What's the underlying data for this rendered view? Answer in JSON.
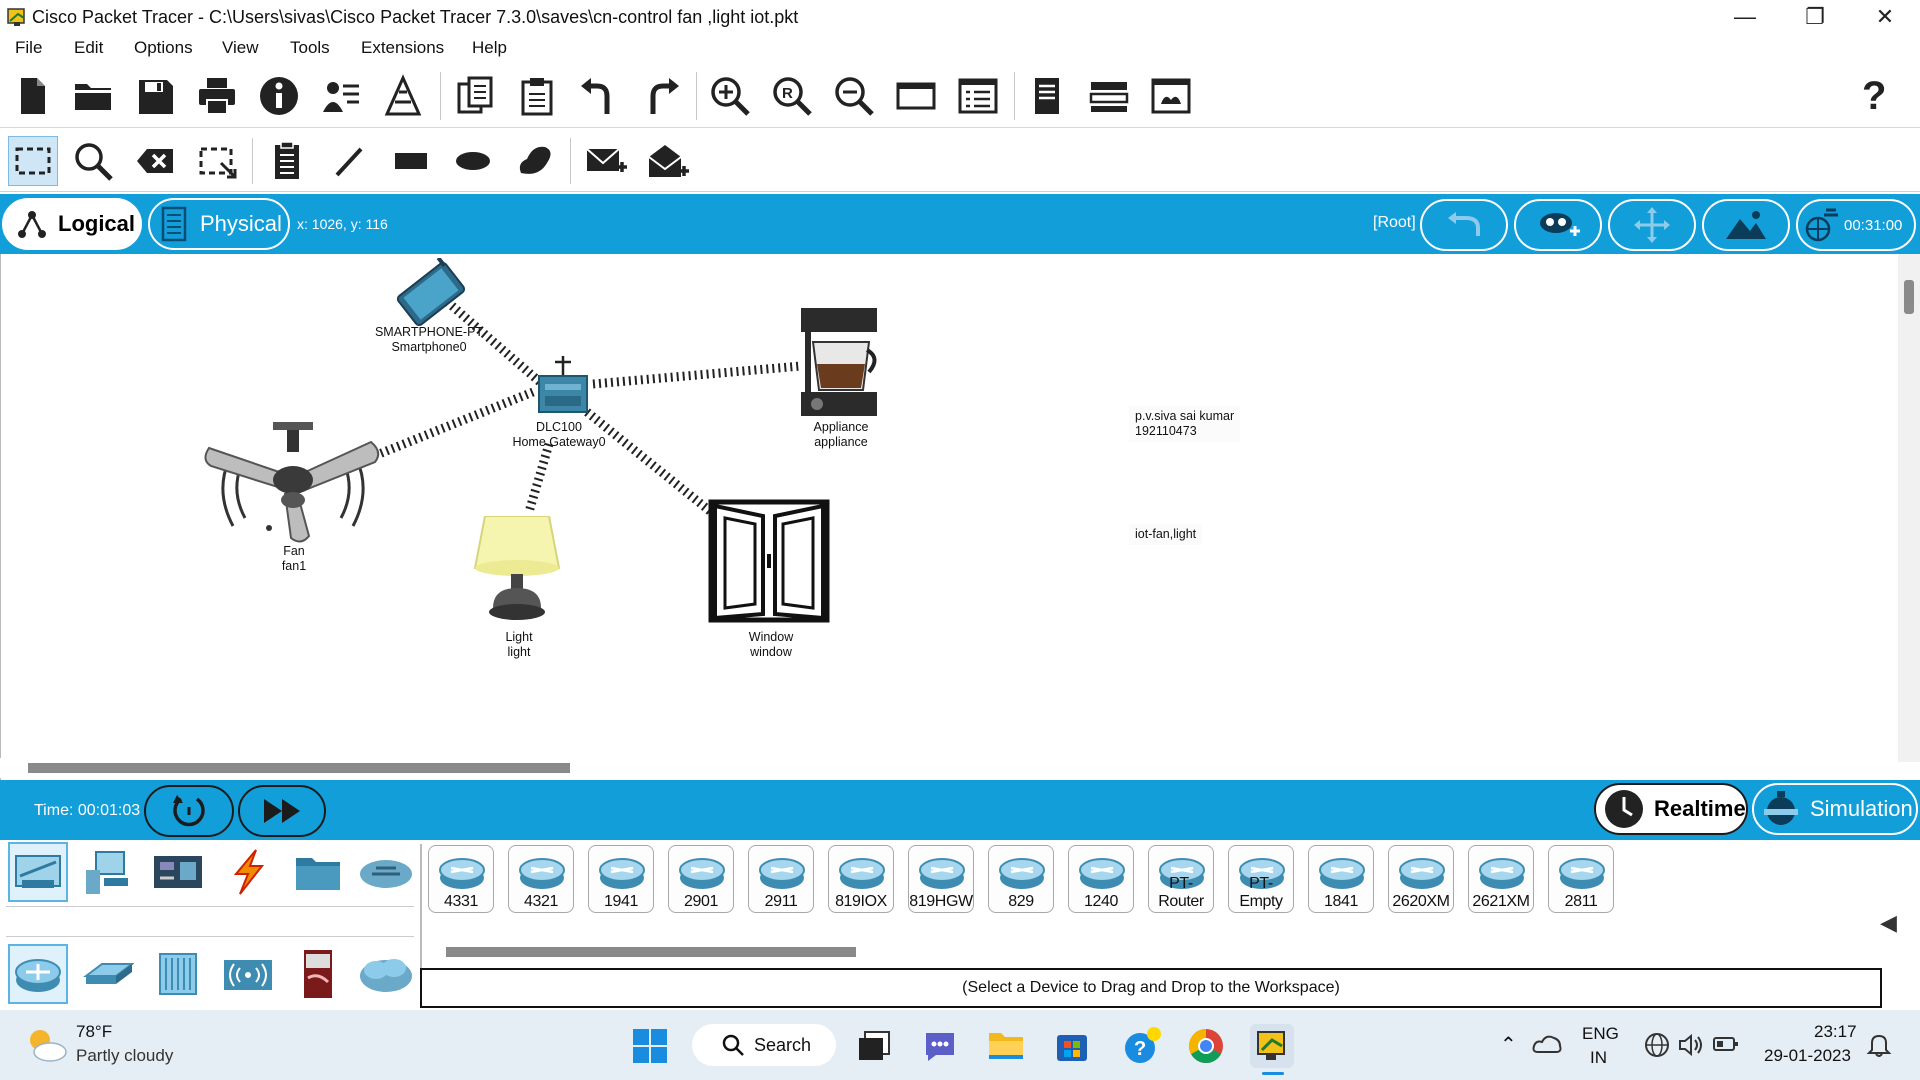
{
  "window": {
    "title": "Cisco Packet Tracer - C:\\Users\\sivas\\Cisco Packet Tracer 7.3.0\\saves\\cn-control fan ,light iot.pkt",
    "minimize_label": "—",
    "maximize_label": "❐",
    "close_label": "✕"
  },
  "menu": [
    "File",
    "Edit",
    "Options",
    "View",
    "Tools",
    "Extensions",
    "Help"
  ],
  "toolbar_main": {
    "icons": [
      "new-file-icon",
      "open-folder-icon",
      "save-icon",
      "print-icon",
      "info-icon",
      "activity-wizard-icon",
      "network-info-icon",
      "copy-icon",
      "paste-icon",
      "undo-icon",
      "redo-icon",
      "zoom-in-icon",
      "zoom-reset-icon",
      "zoom-out-icon",
      "drawing-palette-icon",
      "custom-devices-icon",
      "viewport-icon",
      "cluster-icon",
      "screen-icon"
    ],
    "help_label": "?"
  },
  "toolbar_edit": {
    "icons": [
      "select-icon",
      "inspect-icon",
      "delete-icon",
      "resize-icon",
      "note-icon",
      "line-icon",
      "rectangle-icon",
      "ellipse-icon",
      "freeform-icon",
      "simple-pdu-icon",
      "complex-pdu-icon"
    ]
  },
  "workspace_bar": {
    "logical_label": "Logical",
    "physical_label": "Physical",
    "coords": "x: 1026, y: 116",
    "root_label": "[Root]",
    "clock": "00:31:00"
  },
  "canvas": {
    "devices": [
      {
        "id": "smartphone",
        "line1": "SMARTPHONE-PT",
        "line2": "Smartphone0"
      },
      {
        "id": "gateway",
        "line1": "DLC100",
        "line2": "Home Gateway0"
      },
      {
        "id": "appliance",
        "line1": "Appliance",
        "line2": "appliance"
      },
      {
        "id": "fan",
        "line1": "Fan",
        "line2": "fan1"
      },
      {
        "id": "light",
        "line1": "Light",
        "line2": "light"
      },
      {
        "id": "window",
        "line1": "Window",
        "line2": "window"
      }
    ],
    "notes": [
      {
        "line1": "p.v.siva sai kumar",
        "line2": "192110473"
      },
      {
        "line1": "iot-fan,light"
      }
    ]
  },
  "time_bar": {
    "time": "Time: 00:01:03",
    "realtime_label": "Realtime",
    "simulation_label": "Simulation"
  },
  "device_panel": {
    "categories_top": [
      "network-devices-icon",
      "end-devices-icon",
      "components-icon",
      "connections-icon",
      "miscellaneous-icon",
      "multiuser-icon"
    ],
    "categories_bottom": [
      "routers-icon",
      "switches-icon",
      "hubs-icon",
      "wireless-icon",
      "security-icon",
      "wan-emulation-icon"
    ],
    "models": [
      "4331",
      "4321",
      "1941",
      "2901",
      "2911",
      "819IOX",
      "819HGW",
      "829",
      "1240",
      "PT-Router",
      "PT-Empty",
      "1841",
      "2620XM",
      "2621XM",
      "2811"
    ],
    "hint": "(Select a Device to Drag and Drop to the Workspace)"
  },
  "taskbar": {
    "weather_temp": "78°F",
    "weather_desc": "Partly cloudy",
    "search_label": "Search",
    "lang_line1": "ENG",
    "lang_line2": "IN",
    "time": "23:17",
    "date": "29-01-2023"
  },
  "colors": {
    "accent_blue": "#129ed9",
    "taskbar_bg": "#e6eef5"
  }
}
